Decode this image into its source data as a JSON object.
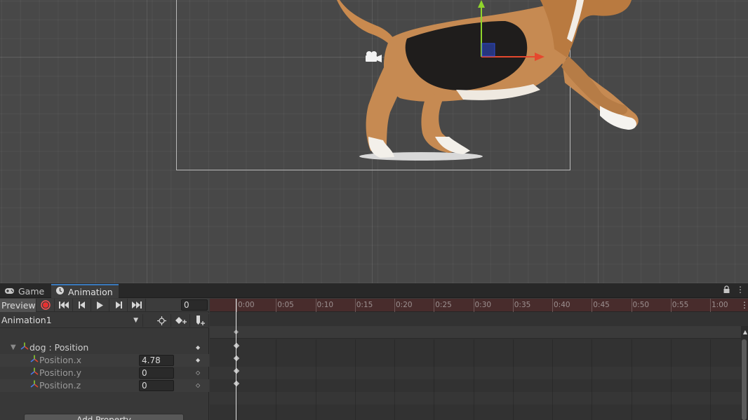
{
  "scene": {
    "colors": {
      "x_axis": "#e5482e",
      "y_axis": "#8fd42b",
      "z_box": "#2c4bd1"
    }
  },
  "tabs": [
    {
      "label": "Game",
      "icon": "gamepad-icon"
    },
    {
      "label": "Animation",
      "icon": "clock-icon"
    }
  ],
  "toolbar": {
    "preview_label": "Preview",
    "frame_value": "0",
    "buttons": [
      "record-icon",
      "first-keyframe-icon",
      "prev-keyframe-icon",
      "play-icon",
      "next-keyframe-icon",
      "last-keyframe-icon"
    ]
  },
  "clip": {
    "name": "Animation1",
    "buttons": [
      "filter-icon",
      "add-keyframe-icon",
      "add-event-icon"
    ]
  },
  "properties": [
    {
      "label": "dog : Position",
      "value": ""
    },
    {
      "label": "Position.x",
      "value": "4.78"
    },
    {
      "label": "Position.y",
      "value": "0"
    },
    {
      "label": "Position.z",
      "value": "0"
    }
  ],
  "add_property_label": "Add Property",
  "timeline": {
    "ticks": [
      "0:00",
      "0:05",
      "0:10",
      "0:15",
      "0:20",
      "0:25",
      "0:30",
      "0:35",
      "0:40",
      "0:45",
      "0:50",
      "0:55",
      "1:00"
    ],
    "ruler_color": "#482c2c"
  }
}
